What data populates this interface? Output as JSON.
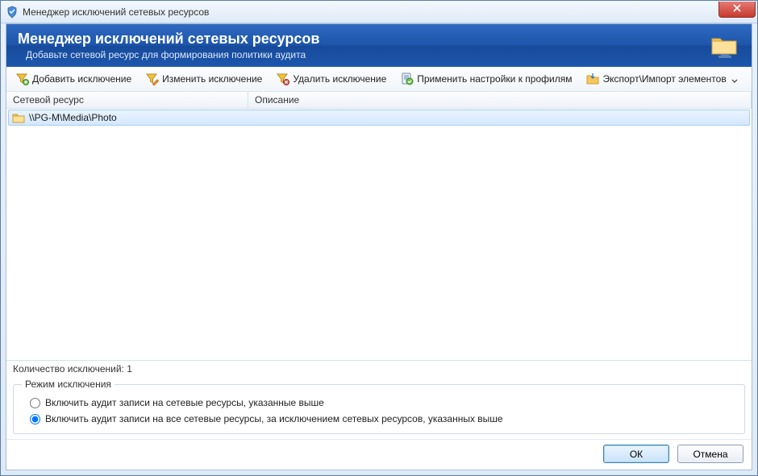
{
  "window": {
    "title": "Менеджер исключений сетевых ресурсов",
    "blurred_suffix": ""
  },
  "header": {
    "title": "Менеджер исключений сетевых ресурсов",
    "subtitle": "Добавьте сетевой ресурс для формирования политики аудита"
  },
  "toolbar": {
    "add": "Добавить исключение",
    "edit": "Изменить исключение",
    "delete": "Удалить исключение",
    "apply": "Применить настройки к профилям",
    "export_import": "Экспорт\\Импорт элементов"
  },
  "columns": {
    "resource": "Сетевой ресурс",
    "description": "Описание"
  },
  "rows": [
    {
      "resource": "\\\\PG-M\\Media\\Photo",
      "description": "",
      "selected": true
    }
  ],
  "count": {
    "label_prefix": "Количество исключений: ",
    "value": "1"
  },
  "mode": {
    "legend": "Режим исключения",
    "option_include": "Включить аудит записи на сетевые ресурсы, указанные выше",
    "option_exclude": "Включить аудит записи на все сетевые ресурсы, за исключением сетевых ресурсов, указанных выше",
    "selected": "exclude"
  },
  "buttons": {
    "ok": "ОК",
    "cancel": "Отмена"
  }
}
